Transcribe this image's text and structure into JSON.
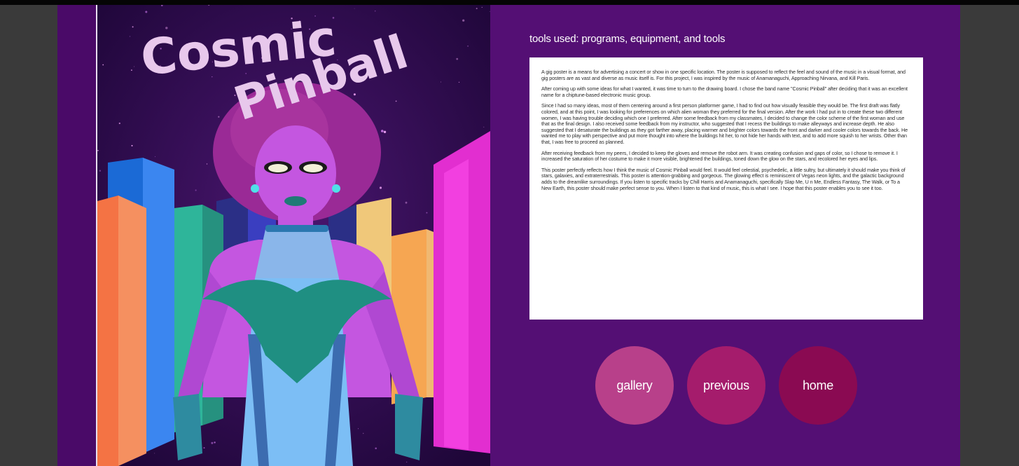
{
  "poster": {
    "title_line1": "Cosmic",
    "title_line2": "Pinball"
  },
  "section": {
    "heading": "tools used: programs, equipment, and tools"
  },
  "body_paragraphs": [
    "A gig poster is a means for advertising a concert or show in one specific location. The poster is supposed to reflect the feel and sound of the music in a visual format, and gig posters are as vast and diverse as music itself is. For this project, I was inspired by the music of Anamanaguchi, Approaching Nirvana, and Kill Paris.",
    "After coming up with some ideas for what I wanted, it was time to turn to the drawing board. I chose the band name \"Cosmic Pinball\" after deciding that it was an excellent name for a chiptune-based electronic music group.",
    "Since I had so many ideas, most of them centering around a first person platformer game, I had to find out how visually feasible they would be. The first draft was flatly colored, and at this point, I was looking for preferences on which alien woman they preferred for the final version. After the work I had put in to create these two different women, I was having trouble deciding which one I preferred. After some feedback from my classmates, I decided to change the color scheme of the first woman and use that as the final design. I also received some feedback from my instructor, who suggested that I recess the buildings to make alleyways and increase depth. He also suggested that I desaturate the buildings as they got farther away, placing warmer and brighter colors towards the front and darker and cooler colors towards the back. He wanted me to play with perspective and put more thought into where the buildings hit her, to not hide her hands with text, and to add more squish to her wrists. Other than that, I was free to proceed as planned.",
    "After receiving feedback from my peers, I decided to keep the gloves and remove the robot arm. It was creating confusion and gaps of color, so I chose to remove it. I increased the saturation of her costume to make it more visible, brightened the buildings, toned down the glow on the stars, and recolored her eyes and lips.",
    "This poster perfectly reflects how I think the music of Cosmic Pinball would feel. It would feel celestial, psychedelic, a little sultry, but ultimately it should make you think of stars, galaxies, and extraterrestrials. This poster is attention-grabbing and gorgeous. The glowing effect is reminiscent of Vegas neon lights, and the galactic background adds to the dreamlike surroundings. If you listen to specific tracks by Chill Harris and Anamanaguchi, specifically Slap Me, U n Me, Endless Fantasy, The Walk, or To a New Earth, this poster should make perfect sense to you. When I listen to that kind of music, this is what I see. I hope that this poster enables you to see it too."
  ],
  "nav": {
    "gallery": {
      "label": "gallery",
      "color": "#b8408a"
    },
    "previous": {
      "label": "previous",
      "color": "#a51c6c"
    },
    "home": {
      "label": "home",
      "color": "#8a0a52"
    }
  },
  "colors": {
    "page_bg": "#540f74",
    "side_panels": "#3a3a3a",
    "poster_sky": "#2a0a4a",
    "title_fill": "#e8c8ec"
  }
}
